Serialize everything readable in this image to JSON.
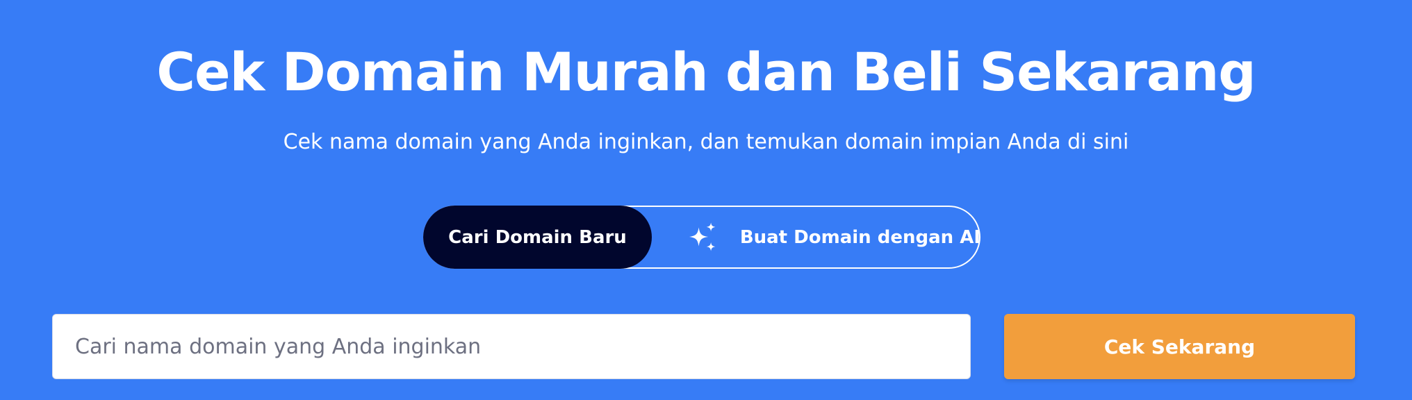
{
  "hero": {
    "title": "Cek Domain Murah dan Beli Sekarang",
    "subtitle": "Cek nama domain yang Anda inginkan, dan temukan domain impian Anda di sini"
  },
  "mode_toggle": {
    "active_tab_label": "Cari Domain Baru",
    "ai_tab_label": "Buat Domain dengan AI",
    "ai_tab_icon": "sparkles-icon"
  },
  "search": {
    "placeholder": "Cari nama domain yang Anda inginkan",
    "value": "",
    "button_label": "Cek Sekarang"
  },
  "colors": {
    "background": "#377cf6",
    "active_tab": "#01062d",
    "button": "#f29e3c",
    "text_light": "#ffffff"
  }
}
